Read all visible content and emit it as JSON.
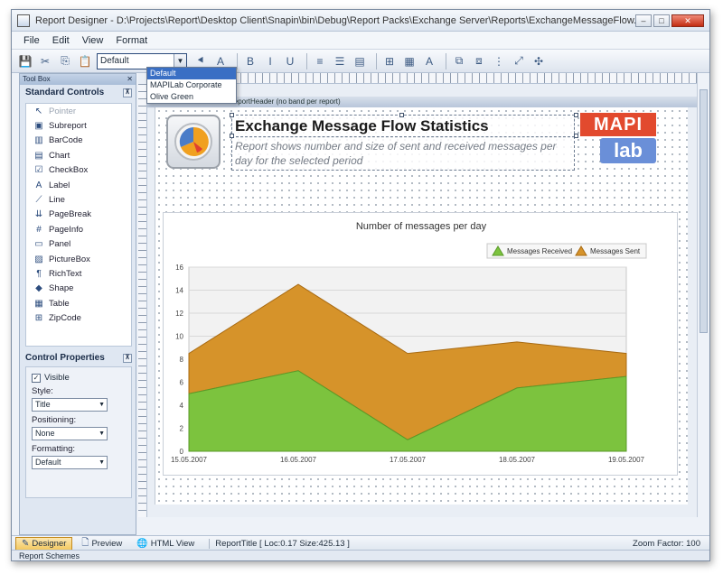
{
  "window": {
    "title": "Report Designer - D:\\Projects\\Report\\Desktop Client\\Snapin\\bin\\Debug\\Report Packs\\Exchange Server\\Reports\\ExchangeMessageFlow.rpxd *",
    "minimize": "–",
    "maximize": "□",
    "close": "✕"
  },
  "menu": [
    "File",
    "Edit",
    "View",
    "Format"
  ],
  "toolbar": {
    "style_value": "Default",
    "style_options": [
      "Default",
      "MAPILab Corporate",
      "Olive Green"
    ]
  },
  "toolbox": {
    "header": "Tool Box",
    "pin": "⊼",
    "standard_title": "Standard Controls",
    "controls": [
      {
        "label": "Pointer",
        "icon": "pointer-icon",
        "glyph": "↖"
      },
      {
        "label": "Subreport",
        "icon": "subreport-icon",
        "glyph": "▣"
      },
      {
        "label": "BarCode",
        "icon": "barcode-icon",
        "glyph": "▥"
      },
      {
        "label": "Chart",
        "icon": "chart-icon",
        "glyph": "▤"
      },
      {
        "label": "CheckBox",
        "icon": "checkbox-icon",
        "glyph": "☑"
      },
      {
        "label": "Label",
        "icon": "label-icon",
        "glyph": "A"
      },
      {
        "label": "Line",
        "icon": "line-icon",
        "glyph": "⟋"
      },
      {
        "label": "PageBreak",
        "icon": "pagebreak-icon",
        "glyph": "⇊"
      },
      {
        "label": "PageInfo",
        "icon": "pageinfo-icon",
        "glyph": "#"
      },
      {
        "label": "Panel",
        "icon": "panel-icon",
        "glyph": "▭"
      },
      {
        "label": "PictureBox",
        "icon": "picturebox-icon",
        "glyph": "▨"
      },
      {
        "label": "RichText",
        "icon": "richtext-icon",
        "glyph": "¶"
      },
      {
        "label": "Shape",
        "icon": "shape-icon",
        "glyph": "◆"
      },
      {
        "label": "Table",
        "icon": "table-icon",
        "glyph": "▦"
      },
      {
        "label": "ZipCode",
        "icon": "zipcode-icon",
        "glyph": "⊞"
      }
    ],
    "props_title": "Control Properties",
    "visible_label": "Visible",
    "visible_check": "✓",
    "style_label": "Style:",
    "style_value": "Title",
    "position_label": "Positioning:",
    "position_value": "None",
    "formatting_label": "Formatting:",
    "formatting_value": "Default"
  },
  "designer": {
    "band_label": "ReportHeader (no band per report)",
    "report_title": "Exchange Message Flow Statistics",
    "report_description": "Report shows number and size of sent and received messages per day for the selected period",
    "brand_top": "MAPI",
    "brand_bottom": "lab"
  },
  "chart_data": {
    "type": "area",
    "title": "Number of messages per day",
    "x": [
      "15.05.2007",
      "16.05.2007",
      "17.05.2007",
      "18.05.2007",
      "19.05.2007"
    ],
    "series": [
      {
        "name": "Messages Received",
        "values": [
          5,
          7,
          1,
          5.5,
          6.5
        ],
        "color": "#7cc33e"
      },
      {
        "name": "Messages Sent",
        "values": [
          3.5,
          7.5,
          7.5,
          4,
          2
        ],
        "color": "#d6932a"
      }
    ],
    "stacked": true,
    "ylim": [
      0,
      16
    ],
    "yticks": [
      0,
      2,
      4,
      6,
      8,
      10,
      12,
      14,
      16
    ],
    "legend": "top-right",
    "grid": true
  },
  "status": {
    "tabs": [
      "Designer",
      "Preview",
      "HTML View"
    ],
    "info": "ReportTitle [ Loc:0.17 Size:425.13 ]",
    "zoom": "Zoom Factor: 100",
    "bottom": "Report Schemes"
  }
}
